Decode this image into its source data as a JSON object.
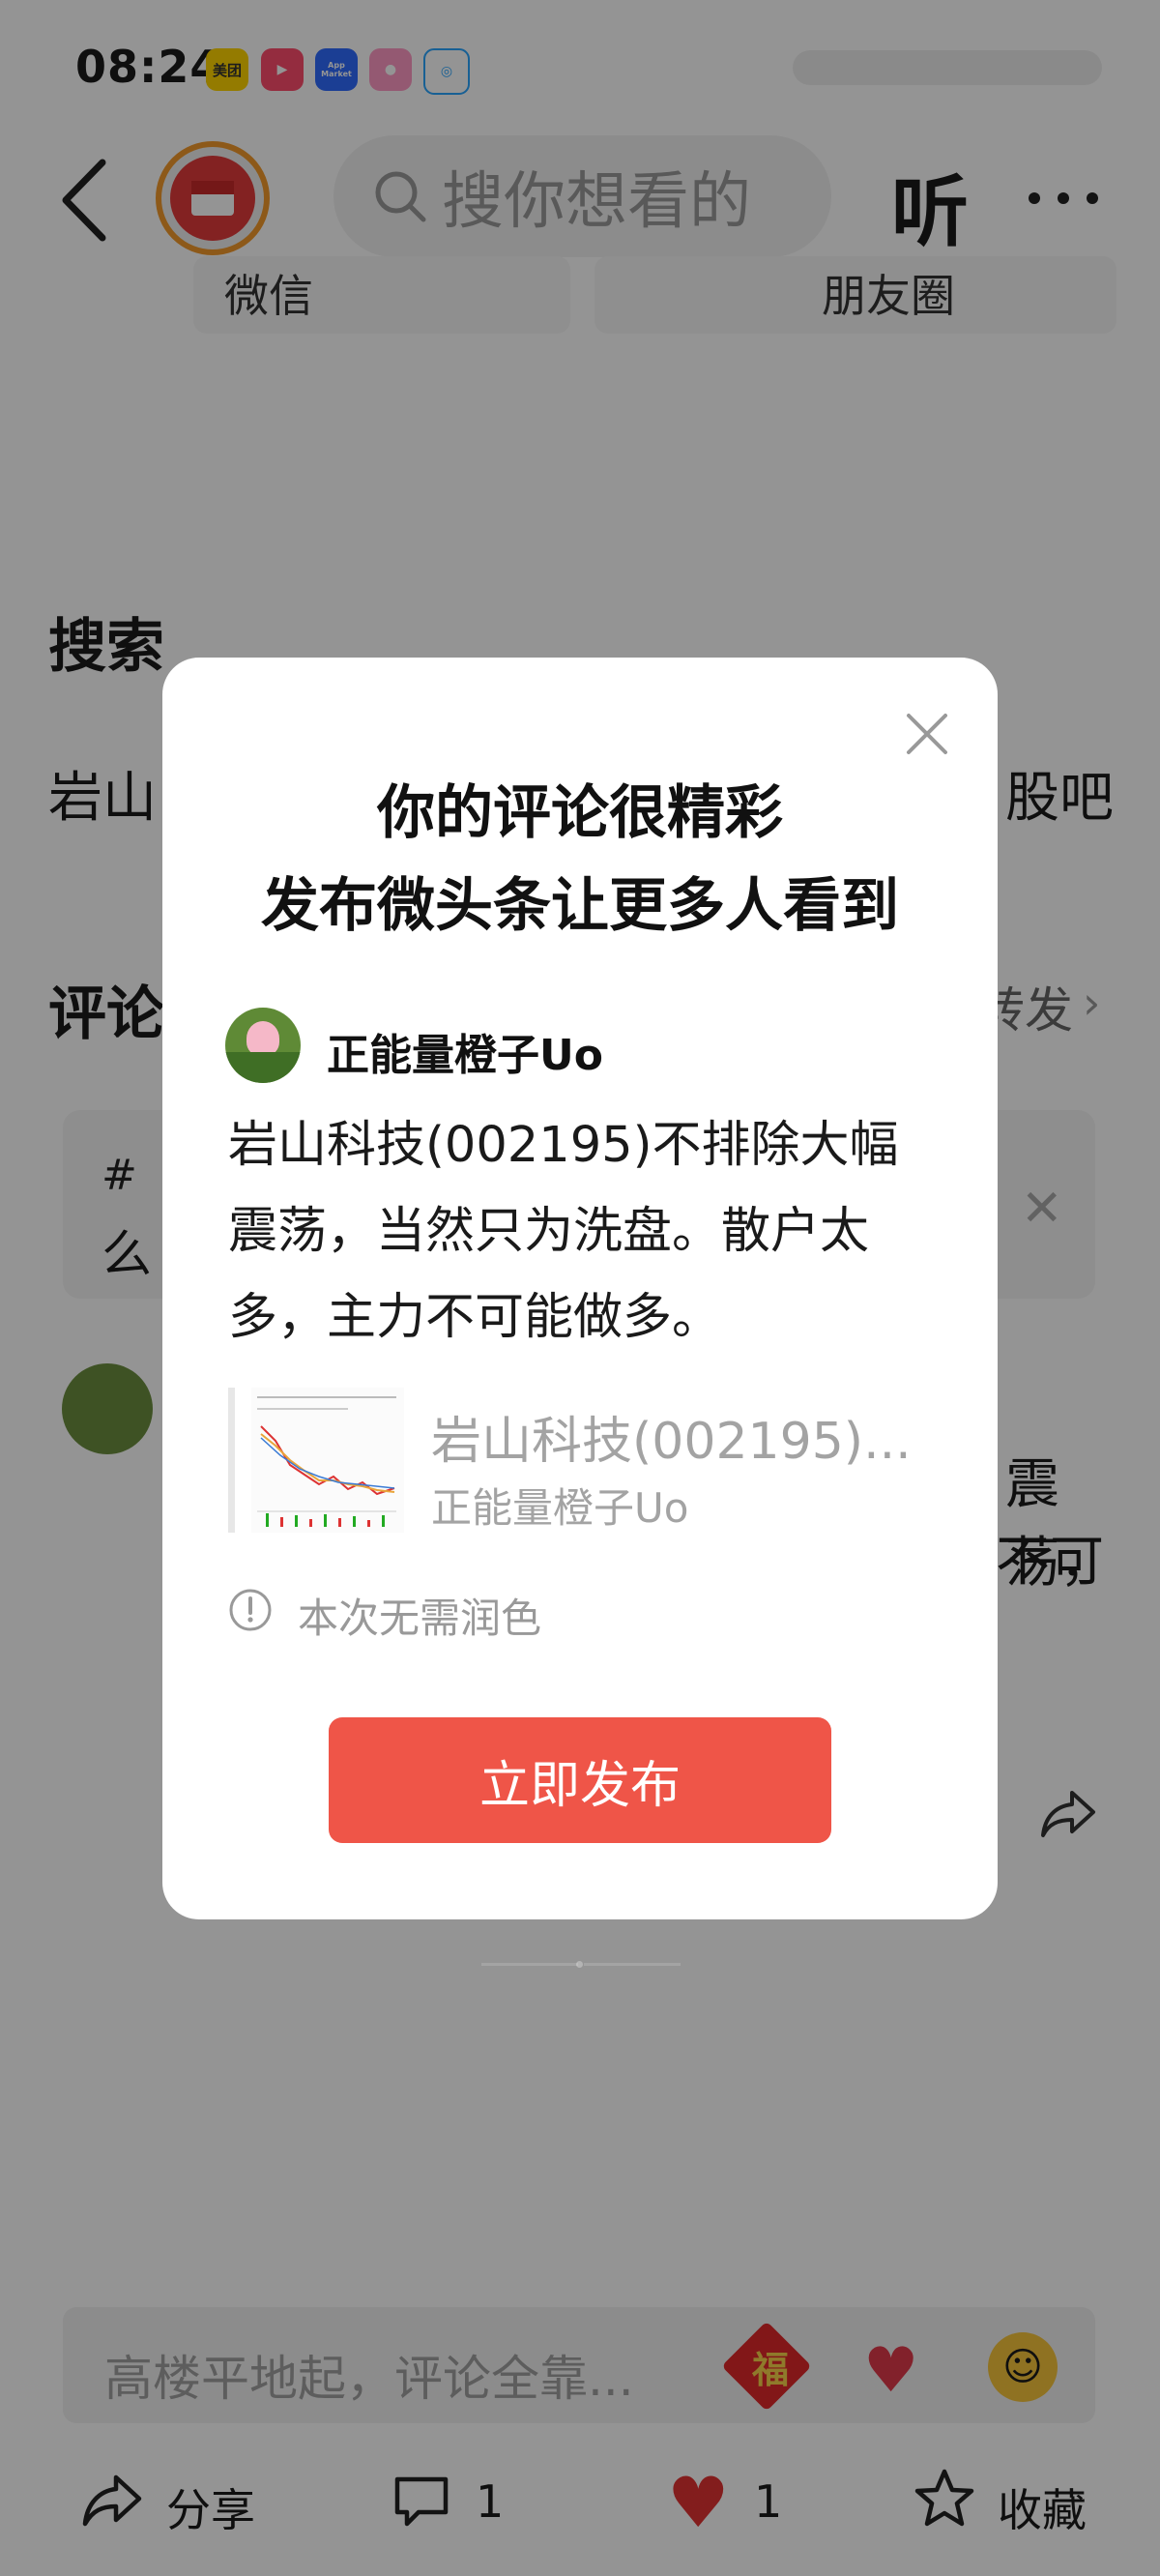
{
  "status_bar": {
    "time": "08:24",
    "apps": [
      "美团",
      "",
      "App Market",
      "",
      ""
    ]
  },
  "nav": {
    "search_placeholder": "搜你想看的",
    "listen_label": "听"
  },
  "share_row": {
    "items": [
      "微信",
      "朋友圈"
    ]
  },
  "background": {
    "search_heading": "搜索",
    "search_text_left": "岩山",
    "search_text_right": "股吧",
    "comments_heading": "评论",
    "forward_label": "转发",
    "tip_box_line": "么"
  },
  "comment_input_placeholder": "高楼平地起，评论全靠...",
  "bottom_bar": {
    "share_label": "分享",
    "comment_count": "1",
    "like_count": "1",
    "favorite_label": "收藏"
  },
  "dialog": {
    "title_line1": "你的评论很精彩",
    "title_line2": "发布微头条让更多人看到",
    "author": "正能量橙子Uo",
    "comment_text": "岩山科技(002195)不排除大幅震荡，当然只为洗盘。散户太多，主力不可能做多。",
    "quoted_title": "岩山科技(002195)...",
    "quoted_author": "正能量橙子Uo",
    "hint": "本次无需润色",
    "publish_button": "立即发布"
  },
  "colors": {
    "accent": "#ef5548",
    "overlay": "rgba(0,0,0,0.42)"
  }
}
